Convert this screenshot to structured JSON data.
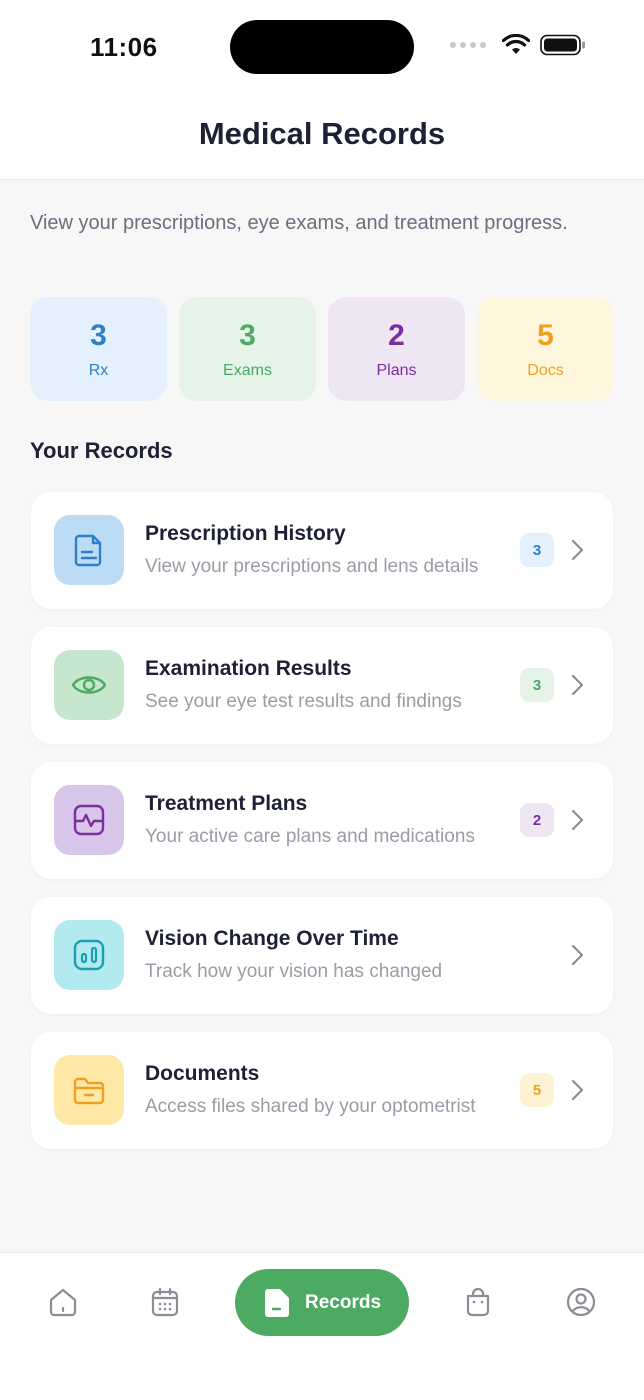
{
  "status": {
    "time": "11:06"
  },
  "header": {
    "title": "Medical Records"
  },
  "intro": "View your prescriptions, eye exams, and treatment progress.",
  "stats": [
    {
      "value": "3",
      "label": "Rx"
    },
    {
      "value": "3",
      "label": "Exams"
    },
    {
      "value": "2",
      "label": "Plans"
    },
    {
      "value": "5",
      "label": "Docs"
    }
  ],
  "section_title": "Your Records",
  "records": [
    {
      "icon": "prescription-icon",
      "title": "Prescription History",
      "desc": "View your prescriptions and lens details",
      "badge": "3"
    },
    {
      "icon": "eye-icon",
      "title": "Examination Results",
      "desc": "See your eye test results and findings",
      "badge": "3"
    },
    {
      "icon": "heartbeat-icon",
      "title": "Treatment Plans",
      "desc": "Your active care plans and medications",
      "badge": "2"
    },
    {
      "icon": "chart-icon",
      "title": "Vision Change Over Time",
      "desc": "Track how your vision has changed",
      "badge": ""
    },
    {
      "icon": "folder-icon",
      "title": "Documents",
      "desc": "Access files shared by your optometrist",
      "badge": "5"
    }
  ],
  "tabbar": {
    "items": [
      "home-icon",
      "calendar-icon",
      "records-icon",
      "shop-icon",
      "profile-icon"
    ],
    "active_label": "Records"
  },
  "colors": {
    "accent": "#4caa62",
    "rx": "#2f7fc6",
    "exams": "#4caa62",
    "plans": "#7b2f9e",
    "docs": "#f0a020"
  }
}
